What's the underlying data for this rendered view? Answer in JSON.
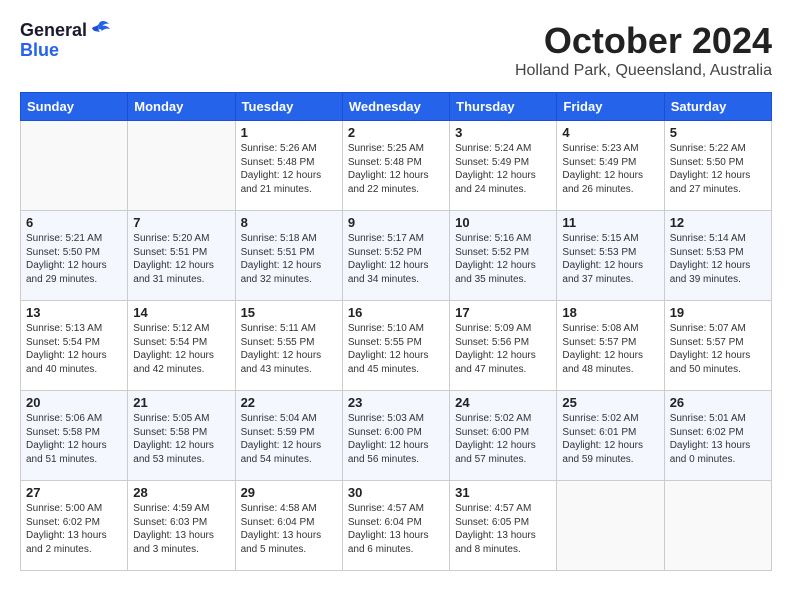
{
  "header": {
    "logo_general": "General",
    "logo_blue": "Blue",
    "month_year": "October 2024",
    "location": "Holland Park, Queensland, Australia"
  },
  "weekdays": [
    "Sunday",
    "Monday",
    "Tuesday",
    "Wednesday",
    "Thursday",
    "Friday",
    "Saturday"
  ],
  "weeks": [
    [
      {
        "day": "",
        "info": ""
      },
      {
        "day": "",
        "info": ""
      },
      {
        "day": "1",
        "info": "Sunrise: 5:26 AM\nSunset: 5:48 PM\nDaylight: 12 hours and 21 minutes."
      },
      {
        "day": "2",
        "info": "Sunrise: 5:25 AM\nSunset: 5:48 PM\nDaylight: 12 hours and 22 minutes."
      },
      {
        "day": "3",
        "info": "Sunrise: 5:24 AM\nSunset: 5:49 PM\nDaylight: 12 hours and 24 minutes."
      },
      {
        "day": "4",
        "info": "Sunrise: 5:23 AM\nSunset: 5:49 PM\nDaylight: 12 hours and 26 minutes."
      },
      {
        "day": "5",
        "info": "Sunrise: 5:22 AM\nSunset: 5:50 PM\nDaylight: 12 hours and 27 minutes."
      }
    ],
    [
      {
        "day": "6",
        "info": "Sunrise: 5:21 AM\nSunset: 5:50 PM\nDaylight: 12 hours and 29 minutes."
      },
      {
        "day": "7",
        "info": "Sunrise: 5:20 AM\nSunset: 5:51 PM\nDaylight: 12 hours and 31 minutes."
      },
      {
        "day": "8",
        "info": "Sunrise: 5:18 AM\nSunset: 5:51 PM\nDaylight: 12 hours and 32 minutes."
      },
      {
        "day": "9",
        "info": "Sunrise: 5:17 AM\nSunset: 5:52 PM\nDaylight: 12 hours and 34 minutes."
      },
      {
        "day": "10",
        "info": "Sunrise: 5:16 AM\nSunset: 5:52 PM\nDaylight: 12 hours and 35 minutes."
      },
      {
        "day": "11",
        "info": "Sunrise: 5:15 AM\nSunset: 5:53 PM\nDaylight: 12 hours and 37 minutes."
      },
      {
        "day": "12",
        "info": "Sunrise: 5:14 AM\nSunset: 5:53 PM\nDaylight: 12 hours and 39 minutes."
      }
    ],
    [
      {
        "day": "13",
        "info": "Sunrise: 5:13 AM\nSunset: 5:54 PM\nDaylight: 12 hours and 40 minutes."
      },
      {
        "day": "14",
        "info": "Sunrise: 5:12 AM\nSunset: 5:54 PM\nDaylight: 12 hours and 42 minutes."
      },
      {
        "day": "15",
        "info": "Sunrise: 5:11 AM\nSunset: 5:55 PM\nDaylight: 12 hours and 43 minutes."
      },
      {
        "day": "16",
        "info": "Sunrise: 5:10 AM\nSunset: 5:55 PM\nDaylight: 12 hours and 45 minutes."
      },
      {
        "day": "17",
        "info": "Sunrise: 5:09 AM\nSunset: 5:56 PM\nDaylight: 12 hours and 47 minutes."
      },
      {
        "day": "18",
        "info": "Sunrise: 5:08 AM\nSunset: 5:57 PM\nDaylight: 12 hours and 48 minutes."
      },
      {
        "day": "19",
        "info": "Sunrise: 5:07 AM\nSunset: 5:57 PM\nDaylight: 12 hours and 50 minutes."
      }
    ],
    [
      {
        "day": "20",
        "info": "Sunrise: 5:06 AM\nSunset: 5:58 PM\nDaylight: 12 hours and 51 minutes."
      },
      {
        "day": "21",
        "info": "Sunrise: 5:05 AM\nSunset: 5:58 PM\nDaylight: 12 hours and 53 minutes."
      },
      {
        "day": "22",
        "info": "Sunrise: 5:04 AM\nSunset: 5:59 PM\nDaylight: 12 hours and 54 minutes."
      },
      {
        "day": "23",
        "info": "Sunrise: 5:03 AM\nSunset: 6:00 PM\nDaylight: 12 hours and 56 minutes."
      },
      {
        "day": "24",
        "info": "Sunrise: 5:02 AM\nSunset: 6:00 PM\nDaylight: 12 hours and 57 minutes."
      },
      {
        "day": "25",
        "info": "Sunrise: 5:02 AM\nSunset: 6:01 PM\nDaylight: 12 hours and 59 minutes."
      },
      {
        "day": "26",
        "info": "Sunrise: 5:01 AM\nSunset: 6:02 PM\nDaylight: 13 hours and 0 minutes."
      }
    ],
    [
      {
        "day": "27",
        "info": "Sunrise: 5:00 AM\nSunset: 6:02 PM\nDaylight: 13 hours and 2 minutes."
      },
      {
        "day": "28",
        "info": "Sunrise: 4:59 AM\nSunset: 6:03 PM\nDaylight: 13 hours and 3 minutes."
      },
      {
        "day": "29",
        "info": "Sunrise: 4:58 AM\nSunset: 6:04 PM\nDaylight: 13 hours and 5 minutes."
      },
      {
        "day": "30",
        "info": "Sunrise: 4:57 AM\nSunset: 6:04 PM\nDaylight: 13 hours and 6 minutes."
      },
      {
        "day": "31",
        "info": "Sunrise: 4:57 AM\nSunset: 6:05 PM\nDaylight: 13 hours and 8 minutes."
      },
      {
        "day": "",
        "info": ""
      },
      {
        "day": "",
        "info": ""
      }
    ]
  ]
}
